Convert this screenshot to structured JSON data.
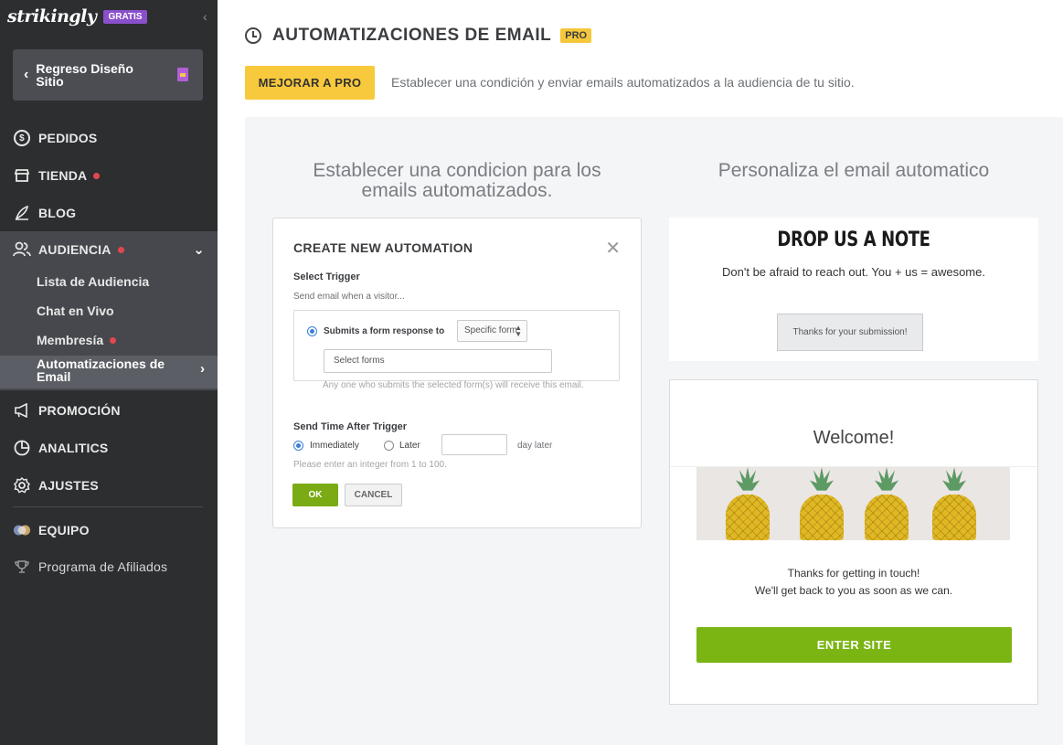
{
  "sidebar": {
    "brand": "strikingly",
    "plan_badge": "GRATIS",
    "back_button": "Regreso Diseño Sitio",
    "items": [
      {
        "label": "PEDIDOS",
        "icon": "dollar-circle-icon"
      },
      {
        "label": "TIENDA",
        "icon": "store-icon",
        "notify": true
      },
      {
        "label": "BLOG",
        "icon": "pen-icon"
      },
      {
        "label": "AUDIENCIA",
        "icon": "people-icon",
        "notify": true,
        "expanded": true
      },
      {
        "label": "PROMOCIÓN",
        "icon": "megaphone-icon"
      },
      {
        "label": "ANALITICS",
        "icon": "pie-chart-icon"
      },
      {
        "label": "AJUSTES",
        "icon": "gear-icon"
      },
      {
        "label": "EQUIPO",
        "icon": "team-icon"
      },
      {
        "label": "Programa de Afiliados",
        "icon": "trophy-icon"
      }
    ],
    "audience_sub": [
      {
        "label": "Lista de Audiencia"
      },
      {
        "label": "Chat en Vivo"
      },
      {
        "label": "Membresía",
        "notify": true
      },
      {
        "label": "Automatizaciones de Email",
        "active": true
      }
    ]
  },
  "header": {
    "title": "AUTOMATIZACIONES DE EMAIL",
    "pro_badge": "PRO",
    "upgrade_button": "MEJORAR A PRO",
    "description": "Establecer una condición y enviar emails automatizados a la audiencia de tu sitio."
  },
  "left_column": {
    "title": "Establecer una condicion para los emails automatizados.",
    "dialog": {
      "title": "CREATE NEW AUTOMATION",
      "select_trigger_label": "Select Trigger",
      "select_trigger_sub": "Send email when a visitor...",
      "form_response_label": "Submits a form response to",
      "form_select_value": "Specific form",
      "forms_placeholder": "Select forms",
      "forms_hint": "Any one who submits the selected form(s) will receive this email.",
      "send_time_label": "Send Time After Trigger",
      "immediately_label": "Immediately",
      "later_label": "Later",
      "day_later_label": "day later",
      "integer_hint": "Please enter an integer  from 1 to 100.",
      "ok_button": "OK",
      "cancel_button": "CANCEL"
    }
  },
  "right_column": {
    "title": "Personaliza el email automatico",
    "note": {
      "title": "DROP US A NOTE",
      "subtitle": "Don't be afraid to reach out. You + us = awesome.",
      "button": "Thanks for your submission!"
    },
    "email": {
      "welcome": "Welcome!",
      "line1": "Thanks for getting in touch!",
      "line2": "We'll get back to you as soon as we can.",
      "button": "ENTER SITE"
    }
  },
  "colors": {
    "sidebar_bg": "#2d2e30",
    "accent_yellow": "#f8c93c",
    "green": "#7ab513",
    "notify_red": "#e2474f",
    "purple_badge": "#8a4fcb"
  }
}
